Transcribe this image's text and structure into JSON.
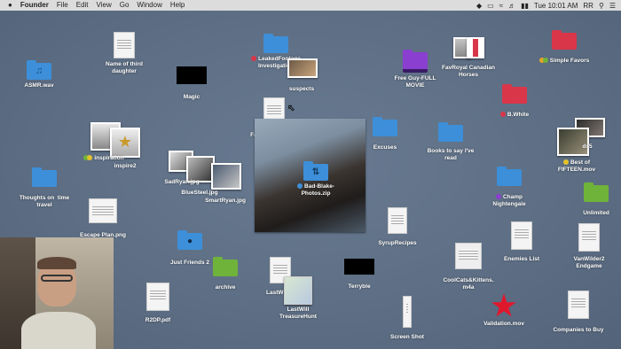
{
  "menubar": {
    "apple": "",
    "app": "Founder",
    "items": [
      "File",
      "Edit",
      "View",
      "Go",
      "Window",
      "Help"
    ],
    "clock": "Tue 10:01 AM",
    "user": "RR"
  },
  "colors": {
    "blue": "#3d8fd9",
    "green": "#6fb33a",
    "red": "#d9364a",
    "purple": "#8a3fd0",
    "desktop": "#5e6f85"
  },
  "items": {
    "name_third": "Name of third\ndaughter",
    "asmr": "ASMR.wav",
    "magic": "Magic",
    "leaked": "LeakedFootage\nInvestigation",
    "suspects": "suspects",
    "freeguy": "Free Guy-FULL\nMOVIE",
    "favroyal": "FavRoyal Canadian\nHorses",
    "simple_favors": "Simple Favors",
    "bwhite": "B.White",
    "favcolours": "FavouriteColours",
    "excuses": "Excuses",
    "books": "Books to say I've\nread",
    "ds5": "ds5",
    "best_fifteen": "Best of\nFIFTEEN.mov",
    "inspiration": "inspiration",
    "inspire2": "inspire2",
    "sadryan": "SadRyan.jpg",
    "bluesteel": "BlueSteel.jpg",
    "smartryan": "SmartRyan.jpg",
    "badblake": "Bad-Blake-\nPhotos.zip",
    "thoughts": "Thoughts on  time\ntravel",
    "champ": "Champ\nNightengale",
    "unlimited": "Unlimited",
    "escape": "Escape Plan.png",
    "syrup": "SyrupRecipes",
    "just_friends": "Just Friends 2",
    "enemies": "Enemies List",
    "vanwilder": "VanWilder2\nEndgame",
    "archive": "archive",
    "lastw": "LastW",
    "lastwill": "LastWill\nTreasureHunt",
    "terryble": "Terryble",
    "coolcats": "CoolCats&Kittens.\nm4a",
    "r2dp": "R2DP.pdf",
    "screenshot": "Screen Shot",
    "validation": "Validation.mov",
    "companies": "Companies to Buy"
  }
}
